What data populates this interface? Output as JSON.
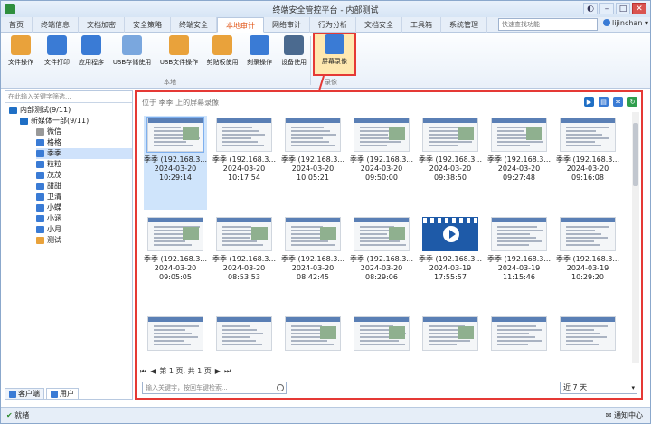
{
  "window": {
    "title": "终端安全管控平台 - 内部测试"
  },
  "menu": {
    "tabs": [
      "首页",
      "终端信息",
      "文档加密",
      "安全策略",
      "终端安全",
      "本地审计",
      "网络审计",
      "行为分析",
      "文档安全",
      "工具箱",
      "系统管理"
    ],
    "active_index": 5
  },
  "quick_search": {
    "placeholder": "快速查找功能"
  },
  "user": {
    "name": "lijinchan"
  },
  "ribbon": {
    "buttons": [
      {
        "label": "文件操作",
        "icon": "file-icon",
        "color": "#e9a23b"
      },
      {
        "label": "文件打印",
        "icon": "printer-icon",
        "color": "#3a7bd5"
      },
      {
        "label": "应用程序",
        "icon": "app-icon",
        "color": "#3a7bd5"
      },
      {
        "label": "USB存储使用",
        "icon": "usb-icon",
        "color": "#7aa7de"
      },
      {
        "label": "USB文件操作",
        "icon": "usb-file-icon",
        "color": "#e9a23b"
      },
      {
        "label": "剪贴板使用",
        "icon": "clipboard-icon",
        "color": "#e9a23b"
      },
      {
        "label": "刻录操作",
        "icon": "disc-icon",
        "color": "#3a7bd5"
      },
      {
        "label": "设备使用",
        "icon": "device-icon",
        "color": "#4b6a8f"
      }
    ],
    "group_local": "本地",
    "screen_record": {
      "label": "屏幕录像",
      "icon": "camera-icon",
      "color": "#3a7bd5"
    },
    "group_record": "录像"
  },
  "left_panel": {
    "search_placeholder": "在此输入关键字筛选...",
    "root": "内部测试(9/11)",
    "dept": "新媒体一部(9/11)",
    "users": [
      "微信",
      "格格",
      "季季",
      "粒粒",
      "茂茂",
      "甜甜",
      "卫清",
      "小蝶",
      "小涵",
      "小月",
      "测试"
    ],
    "selected_user": "季季",
    "tabs": [
      "客户端",
      "用户"
    ]
  },
  "main": {
    "location": "位于 季季 上的屏幕录像",
    "items": [
      {
        "name": "季季 (192.168.3...",
        "date": "2024-03-20",
        "time": "10:29:14",
        "kind": "web"
      },
      {
        "name": "季季 (192.168.3...",
        "date": "2024-03-20",
        "time": "10:17:54",
        "kind": "doc"
      },
      {
        "name": "季季 (192.168.3...",
        "date": "2024-03-20",
        "time": "10:05:21",
        "kind": "doc"
      },
      {
        "name": "季季 (192.168.3...",
        "date": "2024-03-20",
        "time": "09:50:00",
        "kind": "web"
      },
      {
        "name": "季季 (192.168.3...",
        "date": "2024-03-20",
        "time": "09:38:50",
        "kind": "web"
      },
      {
        "name": "季季 (192.168.3...",
        "date": "2024-03-20",
        "time": "09:27:48",
        "kind": "web"
      },
      {
        "name": "季季 (192.168.3...",
        "date": "2024-03-20",
        "time": "09:16:08",
        "kind": "doc"
      },
      {
        "name": "季季 (192.168.3...",
        "date": "2024-03-20",
        "time": "09:05:05",
        "kind": "web"
      },
      {
        "name": "季季 (192.168.3...",
        "date": "2024-03-20",
        "time": "08:53:53",
        "kind": "web"
      },
      {
        "name": "季季 (192.168.3...",
        "date": "2024-03-20",
        "time": "08:42:45",
        "kind": "web"
      },
      {
        "name": "季季 (192.168.3...",
        "date": "2024-03-20",
        "time": "08:29:06",
        "kind": "web"
      },
      {
        "name": "季季 (192.168.3...",
        "date": "2024-03-19",
        "time": "17:55:57",
        "kind": "video"
      },
      {
        "name": "季季 (192.168.3...",
        "date": "2024-03-19",
        "time": "11:15:46",
        "kind": "doc"
      },
      {
        "name": "季季 (192.168.3...",
        "date": "2024-03-19",
        "time": "10:29:20",
        "kind": "doc"
      },
      {
        "name": "",
        "date": "",
        "time": "",
        "kind": "doc"
      },
      {
        "name": "",
        "date": "",
        "time": "",
        "kind": "doc"
      },
      {
        "name": "",
        "date": "",
        "time": "",
        "kind": "web"
      },
      {
        "name": "",
        "date": "",
        "time": "",
        "kind": "web"
      },
      {
        "name": "",
        "date": "",
        "time": "",
        "kind": "web"
      },
      {
        "name": "",
        "date": "",
        "time": "",
        "kind": "doc"
      },
      {
        "name": "",
        "date": "",
        "time": "",
        "kind": "doc"
      }
    ],
    "pager": "第 1 页, 共 1 页",
    "search_placeholder": "输入关键字，按回车键检索...",
    "range": "近 7 天"
  },
  "status": {
    "left": "就绪",
    "right": "通知中心"
  },
  "colors": {
    "highlight": "#e53935",
    "accent": "#3a7bd5",
    "active_tab": "#e05010"
  }
}
